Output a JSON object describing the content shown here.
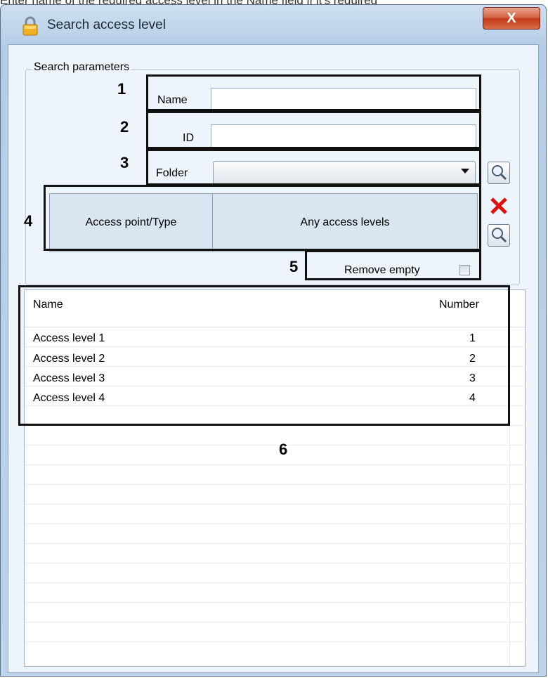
{
  "caption": "Enter name of the required access level in the Name field if it's required",
  "window": {
    "title": "Search access level",
    "close": "X"
  },
  "search": {
    "group_label": "Search parameters",
    "name_label": "Name",
    "name_value": "",
    "id_label": "ID",
    "id_value": "",
    "folder_label": "Folder",
    "folder_value": "",
    "access_point_label": "Access point/Type",
    "access_point_value": "Any access levels",
    "remove_empty_label": "Remove empty",
    "remove_empty_checked": false
  },
  "table": {
    "columns": [
      "Name",
      "Number"
    ],
    "rows": [
      [
        "Access level 1",
        "1"
      ],
      [
        "Access level 2",
        "2"
      ],
      [
        "Access level 3",
        "3"
      ],
      [
        "Access level 4",
        "4"
      ]
    ]
  },
  "annotations": [
    "1",
    "2",
    "3",
    "4",
    "5",
    "6"
  ],
  "icons": {
    "lock": "lock-icon",
    "search": "magnifier-icon",
    "delete": "red-x-icon"
  },
  "colors": {
    "titlebar": "#bcd3ea",
    "close_button": "#c5391a",
    "panel_bg": "#eef4fb",
    "cross": "#e01010"
  }
}
